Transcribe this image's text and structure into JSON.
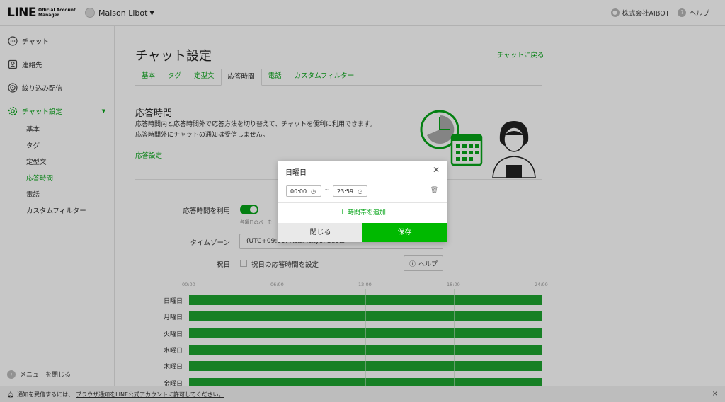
{
  "header": {
    "logo_text": "LINE",
    "logo_sub1": "Official Account",
    "logo_sub2": "Manager",
    "account_name": "Maison Libot",
    "company": "株式会社AIBOT",
    "help": "ヘルプ"
  },
  "sidebar": {
    "items": [
      {
        "label": "チャット",
        "icon": "chat-bubble-icon"
      },
      {
        "label": "連絡先",
        "icon": "contact-icon"
      },
      {
        "label": "絞り込み配信",
        "icon": "target-icon"
      },
      {
        "label": "チャット設定",
        "icon": "gear-icon"
      }
    ],
    "sub_items": [
      "基本",
      "タグ",
      "定型文",
      "応答時間",
      "電話",
      "カスタムフィルター"
    ],
    "active_sub": "応答時間",
    "collapse_label": "メニューを閉じる"
  },
  "main": {
    "title": "チャット設定",
    "back_link": "チャットに戻る",
    "tabs": [
      "基本",
      "タグ",
      "定型文",
      "応答時間",
      "電話",
      "カスタムフィルター"
    ],
    "section_title": "応答時間",
    "desc_line1": "応答時間内と応答時間外で応答方法を切り替えて、チャットを便利に利用できます。",
    "desc_line2": "応答時間外にチャットの通知は受信しません。",
    "settings_link": "応答設定",
    "use_label": "応答時間を利用",
    "use_hint": "各曜日のバーを",
    "tz_label": "タイムゾーン",
    "tz_value": "(UTC+09:00) Asia/Tokyo, Seoul",
    "holiday_label": "祝日",
    "holiday_check": "祝日の応答時間を設定",
    "help_button": "ヘルプ",
    "ticks": [
      "00:00",
      "06:00",
      "12:00",
      "18:00",
      "24:00"
    ],
    "days": [
      "日曜日",
      "月曜日",
      "火曜日",
      "水曜日",
      "木曜日",
      "金曜日"
    ],
    "fill_fraction": 1.0
  },
  "notice": {
    "text": "通知を受信するには、",
    "link": "ブラウザ通知をLINE公式アカウントに許可してください。"
  },
  "modal": {
    "title": "日曜日",
    "start_time": "00:00",
    "end_time": "23:59",
    "tilde": "~",
    "add_slot": "＋ 時間帯を追加",
    "close_button": "閉じる",
    "save_button": "保存"
  },
  "colors": {
    "accent": "#06a518",
    "save": "#00b900",
    "bar": "#1ea530"
  }
}
